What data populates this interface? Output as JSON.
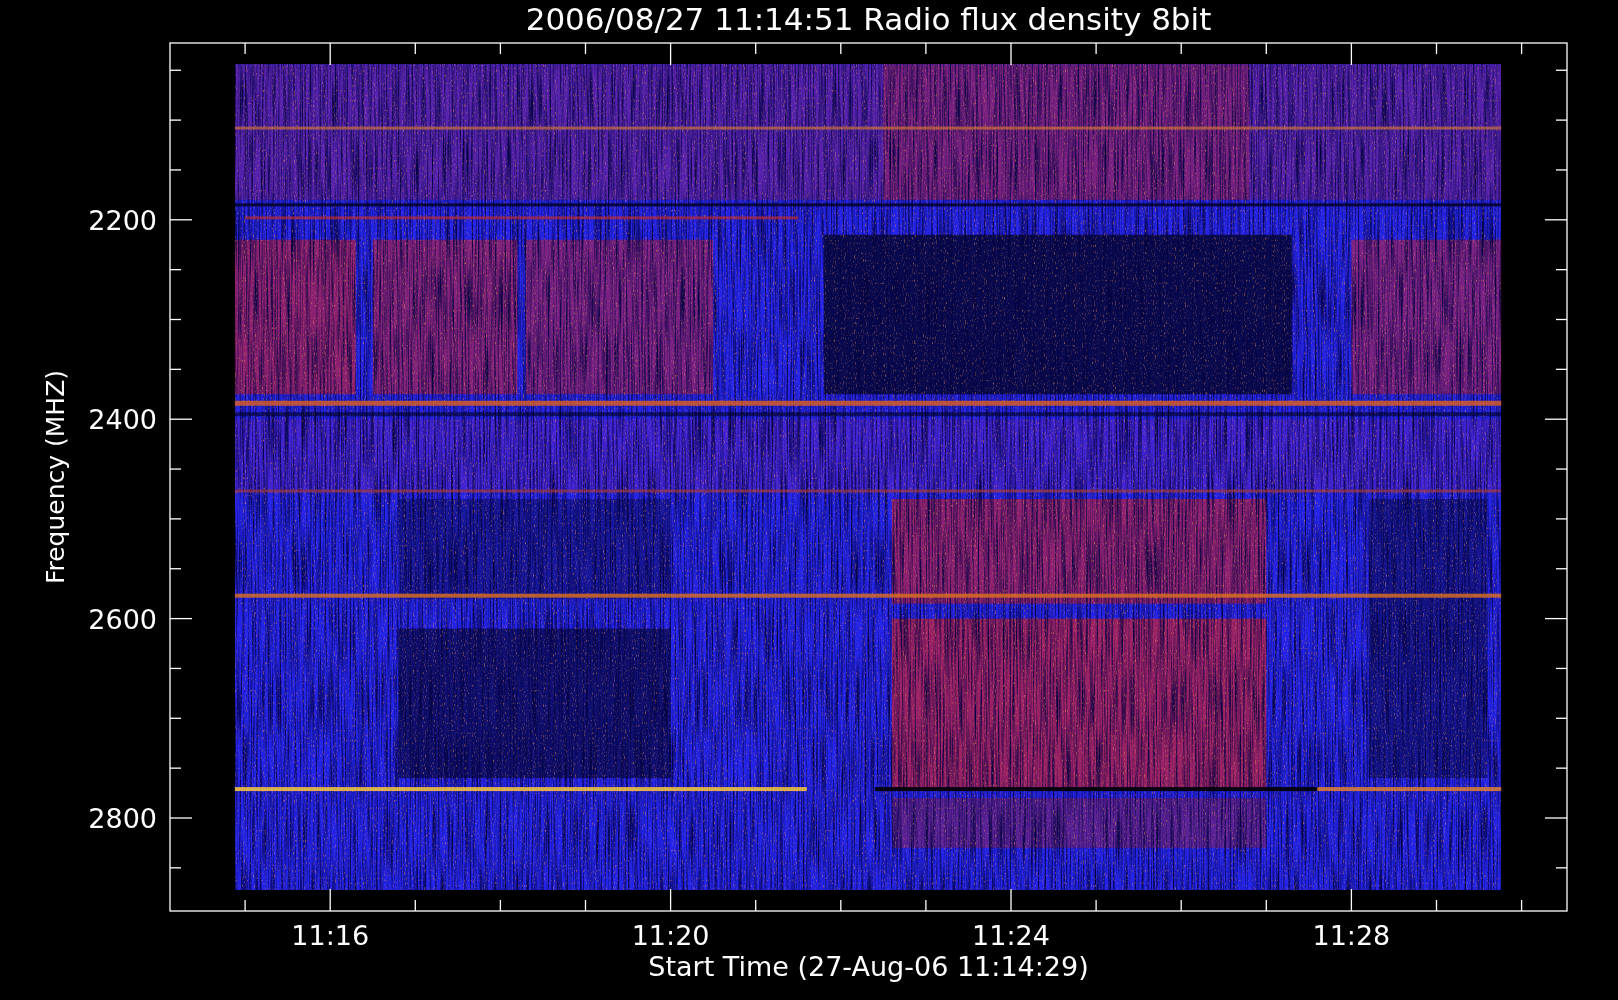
{
  "title": "2006/08/27 11:14:51 Radio flux density 8bit",
  "y_axis": {
    "label": "Frequency (MHZ)",
    "ticks": [
      {
        "label": "2200"
      },
      {
        "label": "2400"
      },
      {
        "label": "2600"
      },
      {
        "label": "2800"
      }
    ]
  },
  "x_axis": {
    "label": "Start Time (27-Aug-06 11:14:29)",
    "ticks": [
      {
        "label": "11:16"
      },
      {
        "label": "11:20"
      },
      {
        "label": "11:24"
      },
      {
        "label": "11:28"
      }
    ]
  }
}
